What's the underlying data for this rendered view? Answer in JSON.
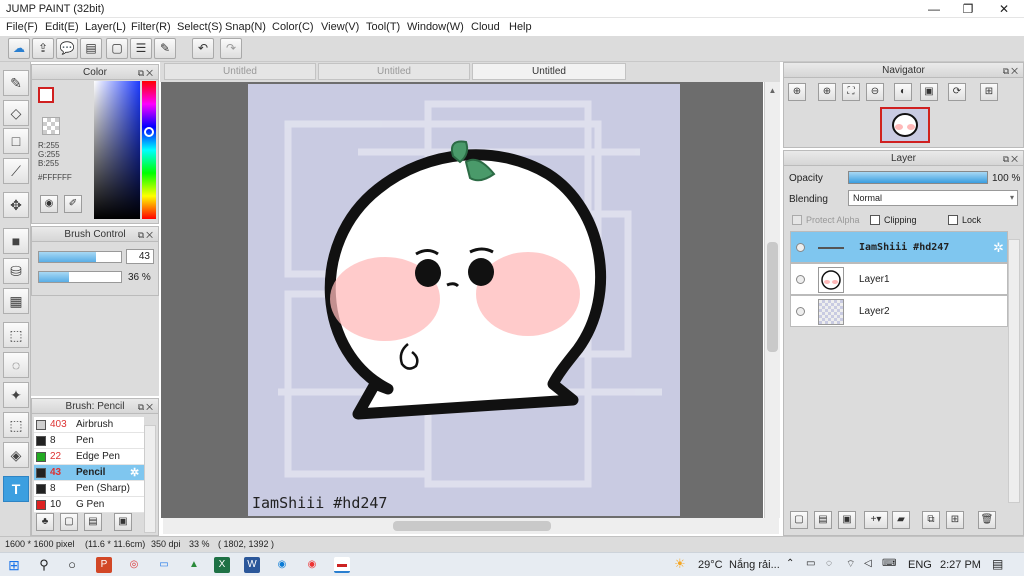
{
  "window": {
    "title": "JUMP PAINT (32bit)",
    "minimize": "—",
    "maximize": "❐",
    "close": "✕"
  },
  "menu": [
    "File(F)",
    "Edit(E)",
    "Layer(L)",
    "Filter(R)",
    "Select(S)",
    "Snap(N)",
    "Color(C)",
    "View(V)",
    "Tool(T)",
    "Window(W)",
    "Cloud",
    "Help"
  ],
  "color_panel": {
    "title": "Color",
    "r": "R:255",
    "g": "G:255",
    "b": "B:255",
    "hex": "#FFFFFF"
  },
  "brush_control": {
    "title": "Brush Control",
    "size": "43",
    "opacity": "36 %",
    "size_fill": 0.7,
    "opacity_fill": 0.36
  },
  "brush_list": {
    "title": "Brush: Pencil",
    "items": [
      {
        "size": "403",
        "name": "Airbrush",
        "color": "#cfcfcf",
        "red": true
      },
      {
        "size": "8",
        "name": "Pen",
        "color": "#222222",
        "red": false
      },
      {
        "size": "22",
        "name": "Edge Pen",
        "color": "#22aa22",
        "red": true
      },
      {
        "size": "43",
        "name": "Pencil",
        "color": "#222222",
        "red": true,
        "selected": true
      },
      {
        "size": "8",
        "name": "Pen (Sharp)",
        "color": "#222222",
        "red": false
      },
      {
        "size": "10",
        "name": "G Pen",
        "color": "#dd2222",
        "red": false
      }
    ]
  },
  "tabs": [
    {
      "label": "Untitled",
      "active": false
    },
    {
      "label": "Untitled",
      "active": false
    },
    {
      "label": "Untitled",
      "active": true
    }
  ],
  "canvas": {
    "watermark": "IamShiii #hd247"
  },
  "navigator": {
    "title": "Navigator"
  },
  "layer_panel": {
    "title": "Layer",
    "opacity_label": "Opacity",
    "opacity_value": "100 %",
    "blending_label": "Blending",
    "blending_value": "Normal",
    "protect_alpha": "Protect Alpha",
    "clipping": "Clipping",
    "lock": "Lock",
    "layers": [
      {
        "name": "IamShiii #hd247",
        "selected": true
      },
      {
        "name": "Layer1",
        "selected": false
      },
      {
        "name": "Layer2",
        "selected": false
      }
    ]
  },
  "status": {
    "size": "1600 * 1600 pixel",
    "cm": "(11.6 * 11.6cm)",
    "dpi": "350 dpi",
    "zoom": "33 %",
    "coords": "( 1802, 1392 )"
  },
  "taskbar": {
    "temperature": "29°C",
    "weather": "Nắng rải...",
    "lang": "ENG",
    "time": "2:27 PM"
  }
}
